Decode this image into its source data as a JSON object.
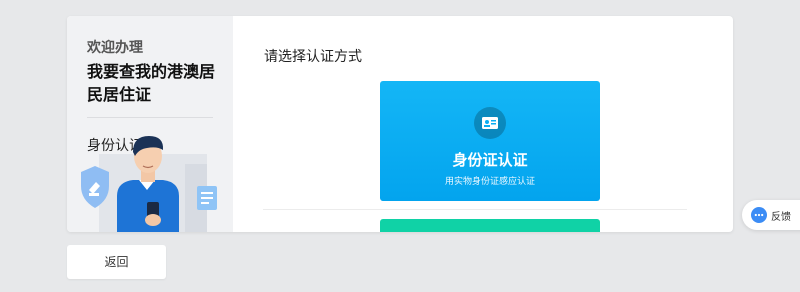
{
  "left_panel": {
    "welcome": "欢迎办理",
    "headline": "我要查我的港澳居民居住证",
    "step_label": "身份认证"
  },
  "main": {
    "section_title": "请选择认证方式",
    "options": [
      {
        "title": "身份证认证",
        "subtitle": "用实物身份证感应认证",
        "icon": "id-card-icon",
        "color": "#0aaef3"
      },
      {
        "color": "#10d2a6"
      }
    ]
  },
  "footer": {
    "back_label": "返回"
  },
  "feedback": {
    "label": "反馈",
    "icon": "chat-bubble-icon",
    "color": "#3b8cf5"
  }
}
